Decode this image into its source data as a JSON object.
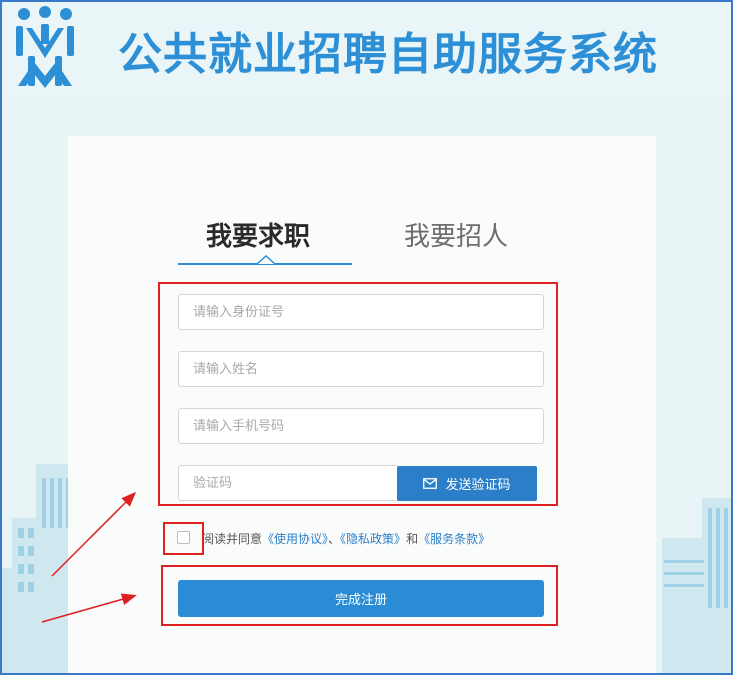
{
  "header": {
    "title": "公共就业招聘自助服务系统",
    "logo_icon": "people-logo-icon"
  },
  "tabs": {
    "seek_job": "我要求职",
    "recruit": "我要招人",
    "active": "seek_job"
  },
  "form": {
    "id_number": {
      "placeholder": "请输入身份证号",
      "value": ""
    },
    "name": {
      "placeholder": "请输入姓名",
      "value": ""
    },
    "phone": {
      "placeholder": "请输入手机号码",
      "value": ""
    },
    "verification_code": {
      "placeholder": "验证码",
      "value": ""
    },
    "send_code_label": "发送验证码",
    "send_code_icon": "mail-icon"
  },
  "agreement": {
    "prefix": "阅读并同意",
    "terms": "《使用协议》",
    "separator": "、",
    "privacy": "《隐私政策》",
    "and": "和",
    "service": "《服务条款》",
    "checked": false
  },
  "submit_label": "完成注册",
  "colors": {
    "brand_blue": "#2d8fd5",
    "button_blue": "#2b7fc8",
    "annotation_red": "#e02020",
    "background": "#e9f5f7"
  }
}
